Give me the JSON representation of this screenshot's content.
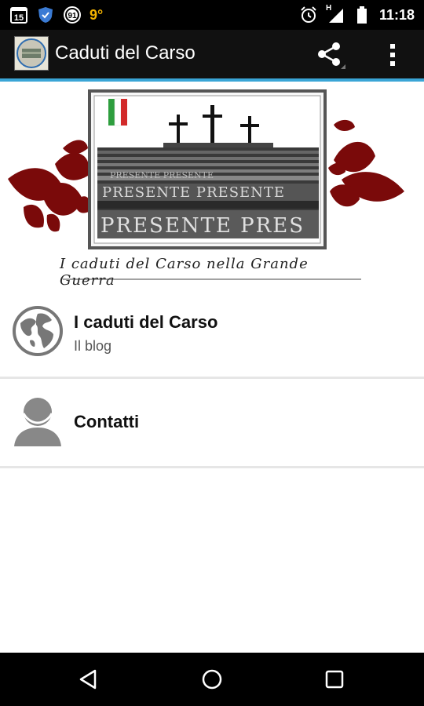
{
  "status_bar": {
    "calendar_day": "15",
    "badge_count": "91",
    "temperature": "9°",
    "network_type": "H",
    "time": "11:18"
  },
  "action_bar": {
    "title": "Caduti del Carso",
    "accent_color": "#3aa5d6"
  },
  "banner": {
    "caption": "I caduti del Carso nella Grande Guerra",
    "sign_text_top": "PRESENTE PRESENTE",
    "sign_text_mid": "PRESENTE PRESENTE",
    "sign_text_bottom": "PRESENTE PRES"
  },
  "list": {
    "items": [
      {
        "title": "I caduti del Carso",
        "subtitle": "Il blog",
        "icon": "globe-icon"
      },
      {
        "title": "Contatti",
        "icon": "person-icon"
      }
    ]
  },
  "nav": {
    "back": "back-icon",
    "home": "home-icon",
    "recents": "recents-icon"
  }
}
